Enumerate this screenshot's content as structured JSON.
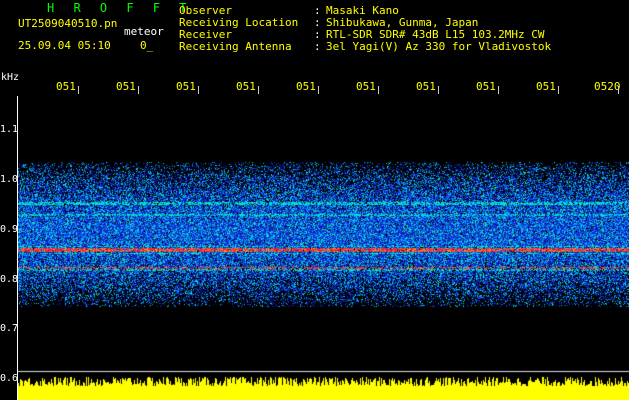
{
  "header": {
    "app_name": "H R O F F T",
    "filename": "UT2509040510.pn",
    "event_type": "meteor",
    "datetime": "25.09.04 05:10",
    "aux_value": "0_"
  },
  "metadata": [
    {
      "label": "Observer",
      "value": "Masaki Kano"
    },
    {
      "label": "Receiving Location",
      "value": "Shibukawa, Gunma, Japan"
    },
    {
      "label": "Receiver",
      "value": "RTL-SDR SDR# 43dB L15 103.2MHz CW"
    },
    {
      "label": "Receiving Antenna",
      "value": "3el Yagi(V) Az 330 for Vladivostok"
    }
  ],
  "separator": ":",
  "axis": {
    "y_unit": "kHz",
    "y_ticks": [
      "1.1",
      "1.0",
      "0.9",
      "0.8",
      "0.7",
      "0.6"
    ],
    "x_ticks": [
      "051",
      "051",
      "051",
      "051",
      "051",
      "051",
      "051",
      "051",
      "051",
      "0520"
    ]
  },
  "colors": {
    "header_green": "#00ff00",
    "text_yellow": "#ffff00",
    "text_white": "#ffffff",
    "background": "#000000",
    "signal_red": "#ff2020",
    "noise_blue": "#1f3cff",
    "noise_cyan": "#00dcff",
    "power_yellow": "#ffff00"
  }
}
